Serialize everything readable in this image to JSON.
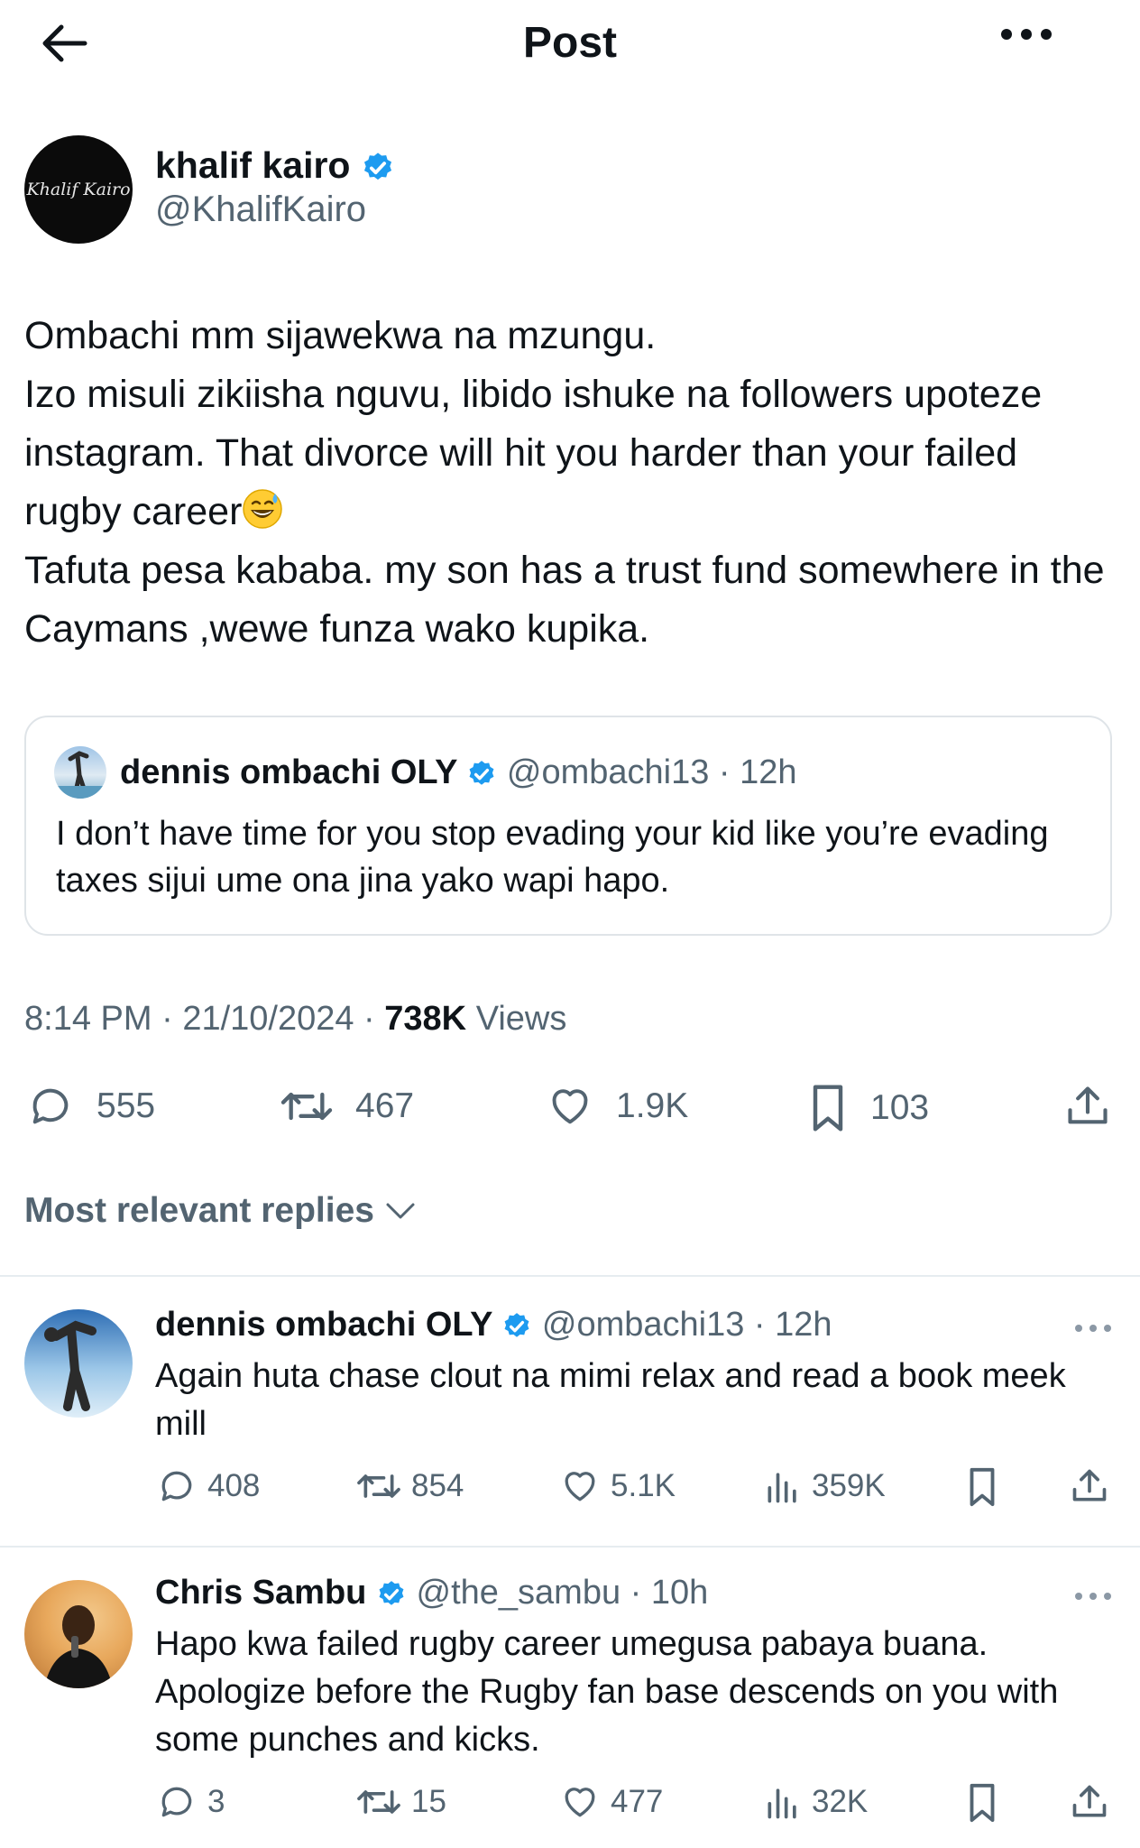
{
  "header": {
    "title": "Post",
    "back_icon": "arrow-left-icon",
    "more_icon": "more-horizontal-icon"
  },
  "post": {
    "author": {
      "name": "khalif kairo",
      "handle": "@KhalifKairo",
      "avatar_text": "Khalif Kairo",
      "verified": true
    },
    "text_lines": [
      "Ombachi mm sijawekwa na mzungu.",
      "Izo misuli zikiisha nguvu, libido ishuke na followers upoteze instagram. That divorce will hit you harder than your failed rugby career",
      "Tafuta pesa kababa. my son has a trust fund somewhere in the Caymans ,wewe funza wako kupika."
    ],
    "quote": {
      "name": "dennis ombachi OLY",
      "handle": "@ombachi13",
      "time": "12h",
      "text": "I don’t have time for you stop evading your kid like you’re evading taxes sijui ume ona jina yako wapi hapo."
    },
    "time": "8:14 PM",
    "date": "21/10/2024",
    "views": "738K",
    "views_label": "Views",
    "stats": {
      "replies": "555",
      "reposts": "467",
      "likes": "1.9K",
      "bookmarks": "103"
    }
  },
  "sort_label": "Most relevant replies",
  "replies": [
    {
      "name": "dennis ombachi OLY",
      "handle": "@ombachi13",
      "time": "12h",
      "text": "Again huta chase clout na mimi relax and read a book meek mill",
      "stats": {
        "replies": "408",
        "reposts": "854",
        "likes": "5.1K",
        "views": "359K"
      }
    },
    {
      "name": "Chris Sambu",
      "handle": "@the_sambu",
      "time": "10h",
      "text": "Hapo kwa failed rugby career umegusa pabaya buana. Apologize before the Rugby  fan base descends on you with some punches and kicks.",
      "stats": {
        "replies": "3",
        "reposts": "15",
        "likes": "477",
        "views": "32K"
      }
    }
  ],
  "colors": {
    "text": "#0f1419",
    "secondary": "#536471",
    "verified": "#1d9bf0",
    "divider": "#e6ecf0"
  }
}
